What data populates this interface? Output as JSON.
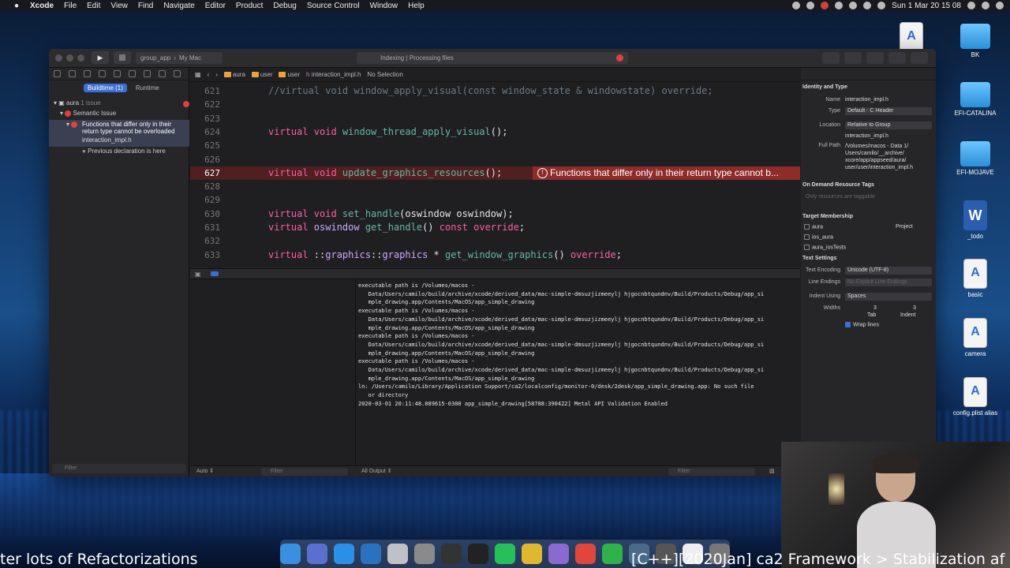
{
  "menubar": {
    "app": "Xcode",
    "items": [
      "File",
      "Edit",
      "View",
      "Find",
      "Navigate",
      "Editor",
      "Product",
      "Debug",
      "Source Control",
      "Window",
      "Help"
    ],
    "clock": "Sun 1 Mar  20 15 08"
  },
  "desktop": {
    "icons": [
      "BK",
      "EFI-CATALINA",
      "EFI-MOJAVE",
      "_todo",
      "basic",
      "camera",
      "config.plist alias"
    ]
  },
  "toolbar": {
    "scheme": "group_app",
    "destination": "My Mac",
    "activity": "Indexing | Processing files",
    "error_count": "1"
  },
  "navigator": {
    "tabs": [
      "Buildtime (1)",
      "Runtime"
    ],
    "project": "aura",
    "project_count": "1 issue",
    "group": "Semantic Issue",
    "issue_line1": "Functions that differ only in their",
    "issue_line2": "return type cannot be overloaded",
    "issue_file": "interaction_impl.h",
    "note": "Previous declaration is here",
    "filter_placeholder": "Filter"
  },
  "jumpbar": {
    "crumbs": [
      "aura",
      "user",
      "user",
      "interaction_impl.h",
      "No Selection"
    ]
  },
  "code": {
    "lines": [
      {
        "num": "621",
        "parts": [
          [
            "cm",
            "//virtual void window_apply_visual(const window_state & windowstate) override;"
          ]
        ]
      },
      {
        "num": "622",
        "parts": []
      },
      {
        "num": "623",
        "parts": []
      },
      {
        "num": "624",
        "parts": [
          [
            "kw",
            "virtual "
          ],
          [
            "kw",
            "void "
          ],
          [
            "fn",
            "window_thread_apply_visual"
          ],
          [
            "tx",
            "();"
          ]
        ]
      },
      {
        "num": "625",
        "parts": []
      },
      {
        "num": "626",
        "parts": []
      },
      {
        "num": "627",
        "parts": [
          [
            "kw",
            "virtual "
          ],
          [
            "kw",
            "void "
          ],
          [
            "fn",
            "update_graphics_resources"
          ],
          [
            "tx",
            "();"
          ]
        ]
      },
      {
        "num": "628",
        "parts": []
      },
      {
        "num": "629",
        "parts": []
      },
      {
        "num": "630",
        "parts": [
          [
            "kw",
            "virtual "
          ],
          [
            "kw",
            "void "
          ],
          [
            "fn",
            "set_handle"
          ],
          [
            "tx",
            "(oswindow oswindow);"
          ]
        ]
      },
      {
        "num": "631",
        "parts": [
          [
            "kw",
            "virtual "
          ],
          [
            "ty",
            "oswindow "
          ],
          [
            "fn",
            "get_handle"
          ],
          [
            "tx",
            "() "
          ],
          [
            "kw",
            "const "
          ],
          [
            "kw",
            "override"
          ],
          [
            "tx",
            ";"
          ]
        ]
      },
      {
        "num": "632",
        "parts": []
      },
      {
        "num": "633",
        "parts": [
          [
            "kw",
            "virtual "
          ],
          [
            "tx",
            "::"
          ],
          [
            "ty",
            "graphics"
          ],
          [
            "tx",
            "::"
          ],
          [
            "ty",
            "graphics "
          ],
          [
            "tx",
            "* "
          ],
          [
            "fn",
            "get_window_graphics"
          ],
          [
            "tx",
            "() "
          ],
          [
            "kw",
            "override"
          ],
          [
            "tx",
            ";"
          ]
        ]
      }
    ],
    "current_line": "627",
    "error_message": "Functions that differ only in their return type cannot b..."
  },
  "console": {
    "lines": [
      "executable path is /Volumes/macos -",
      "   Data/Users/camilo/build/archive/xcode/derived_data/mac-simple-dmsuzjizmeeylj hjgocnbtqundnv/Build/Products/Debug/app_si",
      "   mple_drawing.app/Contents/MacOS/app_simple_drawing",
      "executable path is /Volumes/macos -",
      "   Data/Users/camilo/build/archive/xcode/derived_data/mac-simple-dmsuzjizmeeylj hjgocnbtqundnv/Build/Products/Debug/app_si",
      "   mple_drawing.app/Contents/MacOS/app_simple_drawing",
      "executable path is /Volumes/macos -",
      "   Data/Users/camilo/build/archive/xcode/derived_data/mac-simple-dmsuzjizmeeylj hjgocnbtqundnv/Build/Products/Debug/app_si",
      "   mple_drawing.app/Contents/MacOS/app_simple_drawing",
      "executable path is /Volumes/macos -",
      "   Data/Users/camilo/build/archive/xcode/derived_data/mac-simple-dmsuzjizmeeylj hjgocnbtqundnv/Build/Products/Debug/app_si",
      "   mple_drawing.app/Contents/MacOS/app_simple_drawing",
      "ln: /Users/camilo/Library/Application Support/ca2/localconfig/monitor-0/desk/2desk/app_simple_drawing.app: No such file",
      "   or directory",
      "2020-03-01 20:11:48.089615-0300 app_simple_drawing[58788:390422] Metal API Validation Enabled"
    ]
  },
  "debug_footer": {
    "auto": "Auto",
    "filter": "Filter",
    "output": "All Output",
    "filter2": "Filter"
  },
  "inspector": {
    "identity_title": "Identity and Type",
    "name_label": "Name",
    "name_value": "interaction_impl.h",
    "type_label": "Type",
    "type_value": "Default - C Header",
    "location_label": "Location",
    "location_value": "Relative to Group",
    "location_file": "interaction_impl.h",
    "fullpath_label": "Full Path",
    "fullpath_value": "/Volumes/macos - Data 1/ Users/camilo/__archive/ xcore/app/appseed/aura/ user/user/interaction_impl.h",
    "odr_title": "On Demand Resource Tags",
    "odr_placeholder": "Only resources are taggable",
    "membership_title": "Target Membership",
    "targets": [
      "aura",
      "ios_aura",
      "aura_iosTests"
    ],
    "target_scope": "Project",
    "text_settings_title": "Text Settings",
    "encoding_label": "Text Encoding",
    "encoding_value": "Unicode (UTF-8)",
    "line_endings_label": "Line Endings",
    "line_endings_value": "No Explicit Line Endings",
    "indent_label": "Indent Using",
    "indent_value": "Spaces",
    "widths_label": "Widths",
    "tab_value": "3",
    "indent_width_value": "3",
    "tab_label": "Tab",
    "indent_sub_label": "Indent",
    "wrap_label": "Wrap lines"
  },
  "captions": {
    "left": "ter lots of Refactorizations",
    "right": "[C++][2020Jan] ca2 Framework > Stabilization af"
  }
}
